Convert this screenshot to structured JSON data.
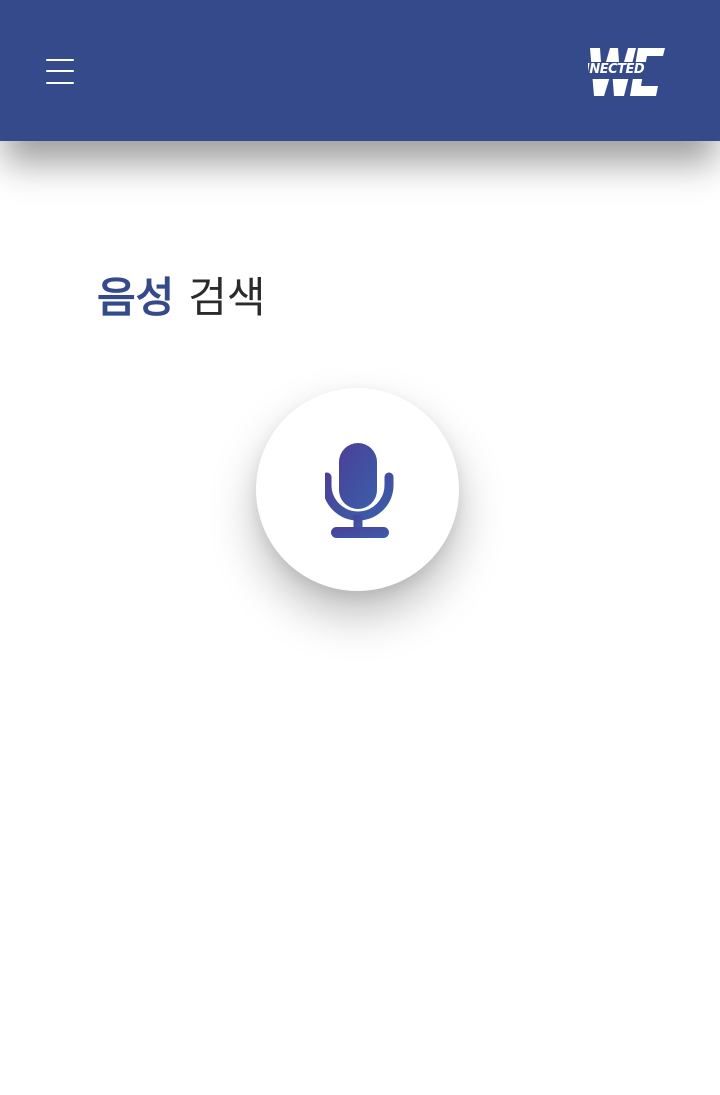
{
  "header": {
    "background_color": "#354a8b",
    "menu_icon": "hamburger-menu-icon",
    "logo": {
      "letters": "WE",
      "word": "NNECTED",
      "color": "#ffffff"
    }
  },
  "main": {
    "title_strong": "음성",
    "title_light": "검색",
    "title_strong_color": "#354a8b",
    "mic_button": {
      "icon": "microphone-icon",
      "icon_gradient": [
        "#4b3f9a",
        "#3a5fa8"
      ]
    }
  }
}
